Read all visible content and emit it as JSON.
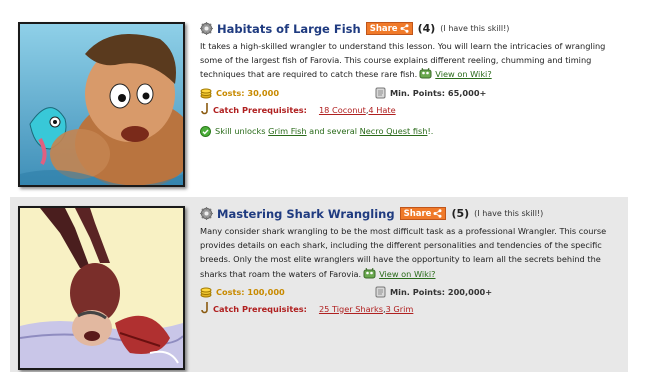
{
  "skills": [
    {
      "title": "Habitats of Large Fish",
      "share_label": "Share",
      "count": "(4)",
      "have_text": "(I have this skill!)",
      "description": "It takes a high-skilled wrangler to understand this lesson. You will learn the intricacies of wrangling some of the largest fish of Farovia. This course explains different reeling, chumming and timing techniques that are required to catch these rare fish.",
      "wiki_label": "View on Wiki?",
      "costs": "Costs: 30,000",
      "min_points": "Min. Points: 65,000+",
      "prereq_label": "Catch Prerequisites:",
      "prereqs": [
        "18 Coconut",
        "4 Hate"
      ],
      "prereq_sep": ", ",
      "unlock": {
        "prefix": "Skill unlocks ",
        "link1": "Grim Fish",
        "middle": " and several ",
        "link2": "Necro Quest fish",
        "suffix": "!."
      }
    },
    {
      "title": "Mastering Shark Wrangling",
      "share_label": "Share",
      "count": "(5)",
      "have_text": "(I have this skill!)",
      "description": "Many consider shark wrangling to be the most difficult task as a professional Wrangler. This course provides details on each shark, including the different personalities and tendencies of the specific breeds. Only the most elite wranglers will have the opportunity to learn all the secrets behind the sharks that roam the waters of Farovia.",
      "wiki_label": "View on Wiki?",
      "costs": "Costs: 100,000",
      "min_points": "Min. Points: 200,000+",
      "prereq_label": "Catch Prerequisites:",
      "prereqs": [
        "25 Tiger Sharks",
        "3 Grim"
      ],
      "prereq_sep": ", "
    }
  ],
  "colors": {
    "title": "#1f3b80",
    "share": "#f07a2a",
    "costs": "#c88a00",
    "prereq": "#b02020",
    "wiki": "#2a6b1a"
  },
  "icons": [
    "gear-icon",
    "share-icon",
    "wiki-creature-icon",
    "coins-icon",
    "points-icon",
    "fishing-hook-icon",
    "check-icon"
  ]
}
